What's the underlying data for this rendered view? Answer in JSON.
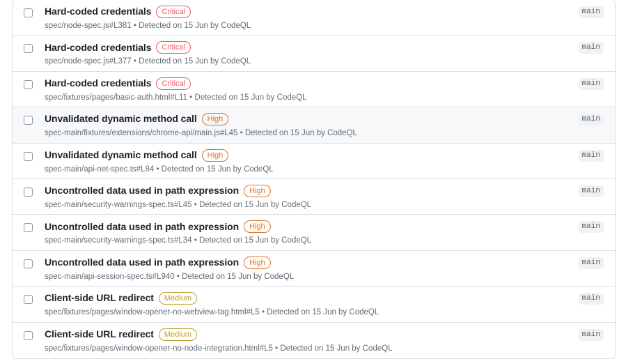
{
  "list": {
    "name": "code-scanning-alerts-list",
    "branch_badge_icon": "branch-badge",
    "checkbox_icon": "checkbox-icon",
    "rows": [
      {
        "title": "Hard-coded credentials",
        "severity": "Critical",
        "severity_key": "critical",
        "meta": "spec/node-spec.js#L381 • Detected on 15 Jun by CodeQL",
        "branch": "main",
        "selected": false,
        "active": false
      },
      {
        "title": "Hard-coded credentials",
        "severity": "Critical",
        "severity_key": "critical",
        "meta": "spec/node-spec.js#L377 • Detected on 15 Jun by CodeQL",
        "branch": "main",
        "selected": false,
        "active": false
      },
      {
        "title": "Hard-coded credentials",
        "severity": "Critical",
        "severity_key": "critical",
        "meta": "spec/fixtures/pages/basic-auth.html#L11 • Detected on 15 Jun by CodeQL",
        "branch": "main",
        "selected": false,
        "active": false
      },
      {
        "title": "Unvalidated dynamic method call",
        "severity": "High",
        "severity_key": "high",
        "meta": "spec-main/fixtures/extensions/chrome-api/main.js#L45 • Detected on 15 Jun by CodeQL",
        "branch": "main",
        "selected": false,
        "active": true
      },
      {
        "title": "Unvalidated dynamic method call",
        "severity": "High",
        "severity_key": "high",
        "meta": "spec-main/api-net-spec.ts#L84 • Detected on 15 Jun by CodeQL",
        "branch": "main",
        "selected": false,
        "active": false
      },
      {
        "title": "Uncontrolled data used in path expression",
        "severity": "High",
        "severity_key": "high",
        "meta": "spec-main/security-warnings-spec.ts#L45 • Detected on 15 Jun by CodeQL",
        "branch": "main",
        "selected": false,
        "active": false
      },
      {
        "title": "Uncontrolled data used in path expression",
        "severity": "High",
        "severity_key": "high",
        "meta": "spec-main/security-warnings-spec.ts#L34 • Detected on 15 Jun by CodeQL",
        "branch": "main",
        "selected": false,
        "active": false
      },
      {
        "title": "Uncontrolled data used in path expression",
        "severity": "High",
        "severity_key": "high",
        "meta": "spec-main/api-session-spec.ts#L940 • Detected on 15 Jun by CodeQL",
        "branch": "main",
        "selected": false,
        "active": false
      },
      {
        "title": "Client-side URL redirect",
        "severity": "Medium",
        "severity_key": "medium",
        "meta": "spec/fixtures/pages/window-opener-no-webview-tag.html#L5 • Detected on 15 Jun by CodeQL",
        "branch": "main",
        "selected": false,
        "active": false
      },
      {
        "title": "Client-side URL redirect",
        "severity": "Medium",
        "severity_key": "medium",
        "meta": "spec/fixtures/pages/window-opener-no-node-integration.html#L5 • Detected on 15 Jun by CodeQL",
        "branch": "main",
        "selected": false,
        "active": false
      }
    ]
  },
  "colors": {
    "critical": "#eb5c63",
    "high": "#d9742a",
    "medium": "#c2a233",
    "border": "#d8dee4",
    "active_row_bg": "#f6f8fa",
    "title": "#1f2328",
    "meta": "#636c76",
    "branch_bg": "#f0f1f3",
    "branch_fg": "#59636e"
  }
}
